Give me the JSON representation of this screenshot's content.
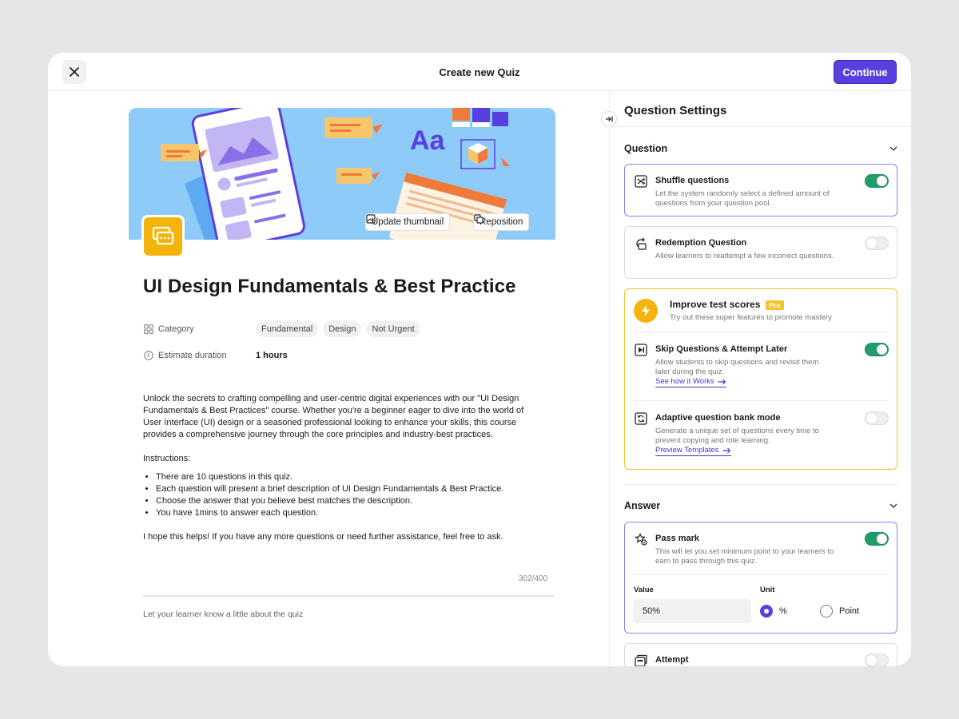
{
  "topbar": {
    "title": "Create new Quiz",
    "continue_label": "Continue"
  },
  "banner": {
    "update_thumbnail_label": "Update thumbnail",
    "reposition_label": "Reposition",
    "illustration_text": "Aa"
  },
  "course": {
    "title": "UI Design Fundamentals & Best Practice",
    "category_label": "Category",
    "tags": [
      "Fundamental",
      "Design",
      "Not Urgent"
    ],
    "duration_label": "Estimate duration",
    "duration_value": "1 hours",
    "description_intro": "Unlock the secrets to crafting compelling and user-centric digital experiences with our \"UI Design Fundamentals & Best Practices\" course. Whether you're a beginner eager to dive into the world of User Interface (UI) design or a seasoned professional looking to enhance your skills, this course provides a comprehensive journey through the core principles and industry-best practices.",
    "instructions_heading": "Instructions:",
    "instructions": [
      "There are 10 questions in this quiz.",
      "Each question will present a brief description of UI Design Fundamentals & Best Practice.",
      "Choose the answer that you believe best matches the description.",
      "You have 1mins to answer each question."
    ],
    "closing": "I hope this helps! If you have any more questions or need further assistance, feel free to ask.",
    "char_count": "302/400",
    "helper_text": "Let your learner know a little about the quiz"
  },
  "settings": {
    "title": "Question Settings",
    "question_section": "Question",
    "shuffle": {
      "title": "Shuffle questions",
      "desc": "Let the system randomly select a defined amount of questions from your question pool.",
      "on": true
    },
    "redemption": {
      "title": "Redemption Question",
      "desc": "Allow learners to reattempt a few incorrect questions.",
      "on": false
    },
    "improve": {
      "title": "Improve test scores",
      "badge": "Pro",
      "desc": "Try out these super features to promote mastery"
    },
    "skip": {
      "title": "Skip Questions & Attempt Later",
      "desc": "Allow students to skip questions and revisit them later during the quiz.",
      "link": "See how it Works",
      "on": true
    },
    "adaptive": {
      "title": "Adaptive question bank mode",
      "desc": "Generate a unique set of questions every time to prevent copying and rote learning.",
      "link": "Preview Templates",
      "on": false
    },
    "answer_section": "Answer",
    "pass_mark": {
      "title": "Pass mark",
      "desc": "This will let you set minimum point to your learners to earn to pass through this quiz.",
      "on": true,
      "value_label": "Value",
      "value": "50%",
      "unit_label": "Unit",
      "unit_options": [
        "%",
        "Point"
      ],
      "unit_selected": "%"
    },
    "attempt": {
      "title": "Attempt",
      "on": false
    }
  },
  "colors": {
    "accent": "#5a3fe0",
    "toggle_on": "#1f9d6b",
    "pro": "#f4c430",
    "icon_yellow": "#f5b40b"
  }
}
